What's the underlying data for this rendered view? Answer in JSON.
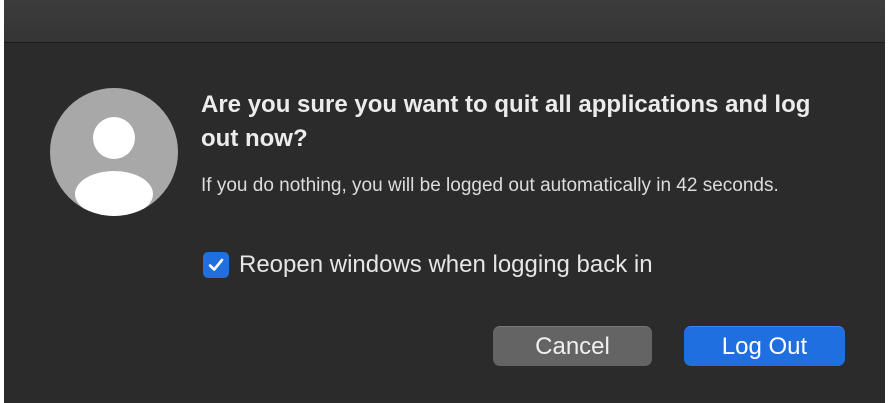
{
  "dialog": {
    "title": "Are you sure you want to quit all applications and log out now?",
    "message": "If you do nothing, you will be logged out automatically in 42 seconds.",
    "countdown_seconds": 42,
    "avatar_icon": "user-silhouette-icon",
    "checkbox": {
      "label": "Reopen windows when logging back in",
      "checked": true,
      "icon": "checkmark-icon"
    },
    "buttons": {
      "cancel_label": "Cancel",
      "logout_label": "Log Out"
    }
  },
  "colors": {
    "background": "#2b2b2b",
    "accent": "#1f6fe0",
    "secondary_button": "#646464",
    "avatar": "#a8a8a8"
  }
}
